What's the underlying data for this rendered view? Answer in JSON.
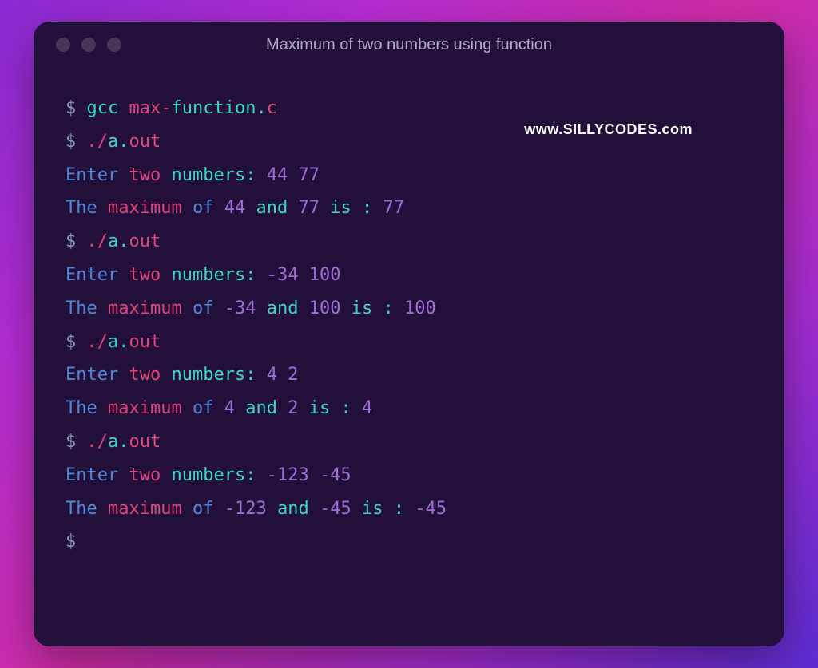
{
  "window": {
    "title": "Maximum of two numbers using function"
  },
  "watermark": "www.SILLYCODES.com",
  "tokens": {
    "prompt": "$",
    "gcc": "gcc",
    "max_hyphen": "max-",
    "function_dot": "function.",
    "c_ext": "c",
    "dot_slash": "./",
    "a_dot": "a.",
    "out": "out",
    "enter": "Enter",
    "two": "two",
    "numbers_colon": "numbers:",
    "the": "The",
    "maximum": "maximum",
    "of": "of",
    "and": "and",
    "is": "is",
    "colon": ":"
  },
  "runs": [
    {
      "n1": "44",
      "n2": "77",
      "max": "77"
    },
    {
      "n1": "-34",
      "n2": "100",
      "max": "100"
    },
    {
      "n1": "4",
      "n2": "2",
      "max": "4"
    },
    {
      "n1": "-123",
      "n2": "-45",
      "max": "-45"
    }
  ]
}
